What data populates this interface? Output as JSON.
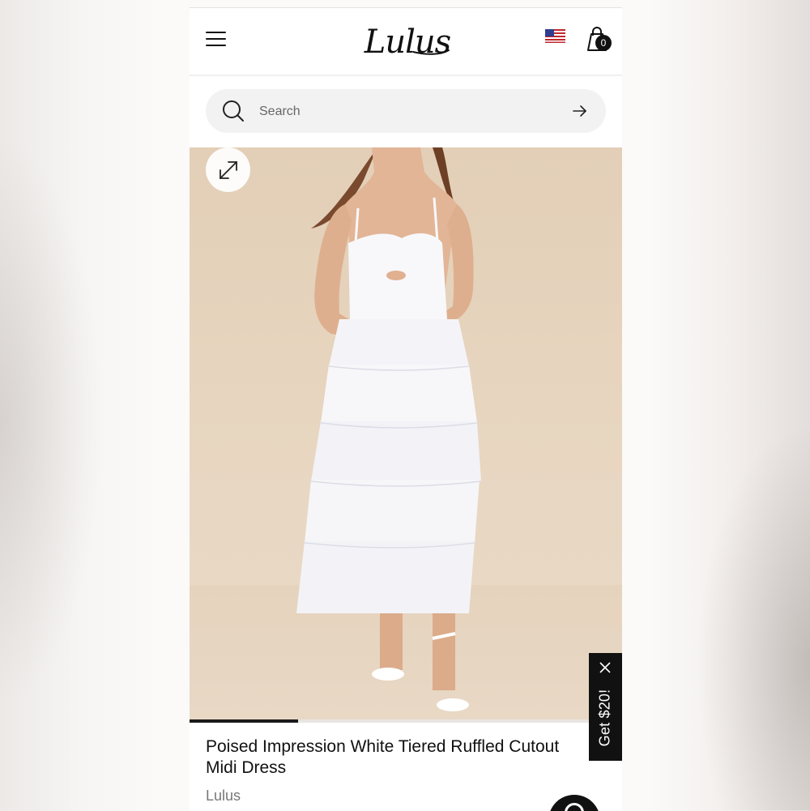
{
  "header": {
    "logo_text": "Lulus",
    "cart_count": "0",
    "icons": [
      "menu-icon",
      "us-flag-icon",
      "shopping-bag-icon"
    ]
  },
  "search": {
    "placeholder": "Search",
    "value": "",
    "icons": [
      "search-icon",
      "arrow-right-icon"
    ]
  },
  "product": {
    "image_icons": [
      "expand-icon"
    ],
    "gallery_progress": 0.25,
    "title": "Poised Impression White Tiered Ruffled Cutout Midi Dress",
    "brand": "Lulus"
  },
  "promo": {
    "label": "Get $20!",
    "icons": [
      "close-icon"
    ]
  },
  "chat": {
    "icons": [
      "chat-icon"
    ]
  },
  "colors": {
    "accent": "#111111",
    "search_bg": "#f2f2f2",
    "photo_bg": "#e5d2bc",
    "brand_text": "#777777"
  }
}
